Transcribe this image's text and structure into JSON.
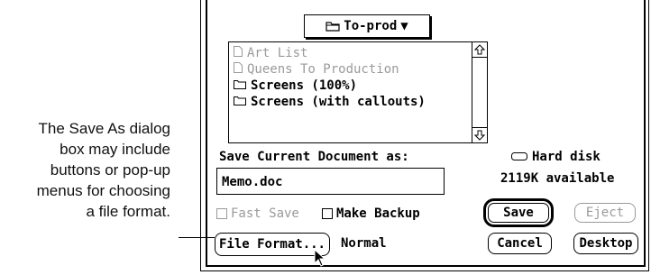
{
  "callout": {
    "lines": [
      "The Save As dialog",
      "box may include",
      "buttons or pop-up",
      "menus for choosing",
      "a file format."
    ]
  },
  "dialog": {
    "folder_popup": {
      "label": "To-prod",
      "icon": "folder-icon",
      "caret": "▼"
    },
    "file_list": [
      {
        "name": "Art List",
        "icon": "document-icon",
        "style": "dim"
      },
      {
        "name": "Queens To Production",
        "icon": "document-icon",
        "style": "dim"
      },
      {
        "name": "Screens (100%)",
        "icon": "folder-icon",
        "style": "bold"
      },
      {
        "name": "Screens (with callouts)",
        "icon": "folder-icon",
        "style": "bold"
      }
    ],
    "save_label": "Save Current Document as:",
    "filename_value": "Memo.doc",
    "disk_name": "Hard disk",
    "disk_icon": "hard-disk-icon",
    "available": "2119K available",
    "fast_save_label": "Fast Save",
    "make_backup_label": "Make Backup",
    "save_button": "Save",
    "eject_button": "Eject",
    "cancel_button": "Cancel",
    "desktop_button": "Desktop",
    "file_format_button": "File Format...",
    "file_format_value": "Normal"
  }
}
